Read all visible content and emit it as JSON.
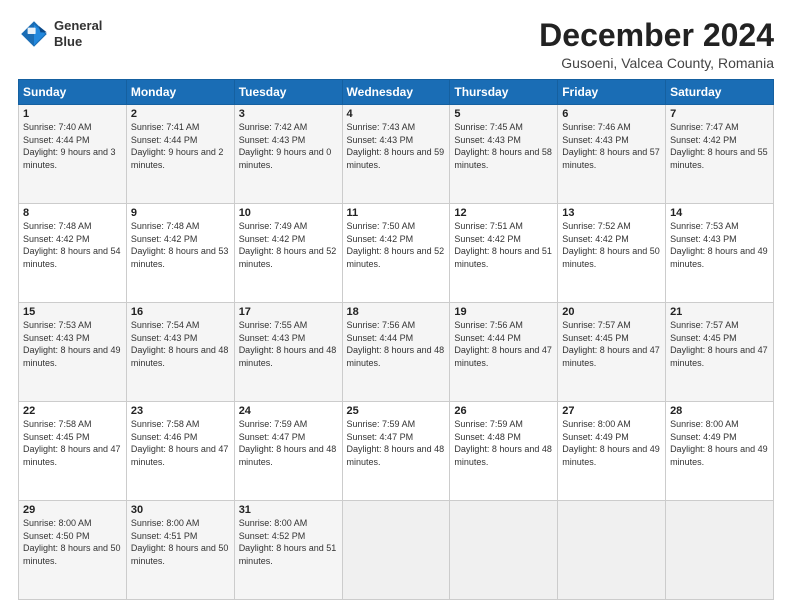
{
  "logo": {
    "line1": "General",
    "line2": "Blue"
  },
  "title": "December 2024",
  "subtitle": "Gusoeni, Valcea County, Romania",
  "days_of_week": [
    "Sunday",
    "Monday",
    "Tuesday",
    "Wednesday",
    "Thursday",
    "Friday",
    "Saturday"
  ],
  "weeks": [
    [
      {
        "day": "1",
        "sunrise": "Sunrise: 7:40 AM",
        "sunset": "Sunset: 4:44 PM",
        "daylight": "Daylight: 9 hours and 3 minutes."
      },
      {
        "day": "2",
        "sunrise": "Sunrise: 7:41 AM",
        "sunset": "Sunset: 4:44 PM",
        "daylight": "Daylight: 9 hours and 2 minutes."
      },
      {
        "day": "3",
        "sunrise": "Sunrise: 7:42 AM",
        "sunset": "Sunset: 4:43 PM",
        "daylight": "Daylight: 9 hours and 0 minutes."
      },
      {
        "day": "4",
        "sunrise": "Sunrise: 7:43 AM",
        "sunset": "Sunset: 4:43 PM",
        "daylight": "Daylight: 8 hours and 59 minutes."
      },
      {
        "day": "5",
        "sunrise": "Sunrise: 7:45 AM",
        "sunset": "Sunset: 4:43 PM",
        "daylight": "Daylight: 8 hours and 58 minutes."
      },
      {
        "day": "6",
        "sunrise": "Sunrise: 7:46 AM",
        "sunset": "Sunset: 4:43 PM",
        "daylight": "Daylight: 8 hours and 57 minutes."
      },
      {
        "day": "7",
        "sunrise": "Sunrise: 7:47 AM",
        "sunset": "Sunset: 4:42 PM",
        "daylight": "Daylight: 8 hours and 55 minutes."
      }
    ],
    [
      {
        "day": "8",
        "sunrise": "Sunrise: 7:48 AM",
        "sunset": "Sunset: 4:42 PM",
        "daylight": "Daylight: 8 hours and 54 minutes."
      },
      {
        "day": "9",
        "sunrise": "Sunrise: 7:48 AM",
        "sunset": "Sunset: 4:42 PM",
        "daylight": "Daylight: 8 hours and 53 minutes."
      },
      {
        "day": "10",
        "sunrise": "Sunrise: 7:49 AM",
        "sunset": "Sunset: 4:42 PM",
        "daylight": "Daylight: 8 hours and 52 minutes."
      },
      {
        "day": "11",
        "sunrise": "Sunrise: 7:50 AM",
        "sunset": "Sunset: 4:42 PM",
        "daylight": "Daylight: 8 hours and 52 minutes."
      },
      {
        "day": "12",
        "sunrise": "Sunrise: 7:51 AM",
        "sunset": "Sunset: 4:42 PM",
        "daylight": "Daylight: 8 hours and 51 minutes."
      },
      {
        "day": "13",
        "sunrise": "Sunrise: 7:52 AM",
        "sunset": "Sunset: 4:42 PM",
        "daylight": "Daylight: 8 hours and 50 minutes."
      },
      {
        "day": "14",
        "sunrise": "Sunrise: 7:53 AM",
        "sunset": "Sunset: 4:43 PM",
        "daylight": "Daylight: 8 hours and 49 minutes."
      }
    ],
    [
      {
        "day": "15",
        "sunrise": "Sunrise: 7:53 AM",
        "sunset": "Sunset: 4:43 PM",
        "daylight": "Daylight: 8 hours and 49 minutes."
      },
      {
        "day": "16",
        "sunrise": "Sunrise: 7:54 AM",
        "sunset": "Sunset: 4:43 PM",
        "daylight": "Daylight: 8 hours and 48 minutes."
      },
      {
        "day": "17",
        "sunrise": "Sunrise: 7:55 AM",
        "sunset": "Sunset: 4:43 PM",
        "daylight": "Daylight: 8 hours and 48 minutes."
      },
      {
        "day": "18",
        "sunrise": "Sunrise: 7:56 AM",
        "sunset": "Sunset: 4:44 PM",
        "daylight": "Daylight: 8 hours and 48 minutes."
      },
      {
        "day": "19",
        "sunrise": "Sunrise: 7:56 AM",
        "sunset": "Sunset: 4:44 PM",
        "daylight": "Daylight: 8 hours and 47 minutes."
      },
      {
        "day": "20",
        "sunrise": "Sunrise: 7:57 AM",
        "sunset": "Sunset: 4:45 PM",
        "daylight": "Daylight: 8 hours and 47 minutes."
      },
      {
        "day": "21",
        "sunrise": "Sunrise: 7:57 AM",
        "sunset": "Sunset: 4:45 PM",
        "daylight": "Daylight: 8 hours and 47 minutes."
      }
    ],
    [
      {
        "day": "22",
        "sunrise": "Sunrise: 7:58 AM",
        "sunset": "Sunset: 4:45 PM",
        "daylight": "Daylight: 8 hours and 47 minutes."
      },
      {
        "day": "23",
        "sunrise": "Sunrise: 7:58 AM",
        "sunset": "Sunset: 4:46 PM",
        "daylight": "Daylight: 8 hours and 47 minutes."
      },
      {
        "day": "24",
        "sunrise": "Sunrise: 7:59 AM",
        "sunset": "Sunset: 4:47 PM",
        "daylight": "Daylight: 8 hours and 48 minutes."
      },
      {
        "day": "25",
        "sunrise": "Sunrise: 7:59 AM",
        "sunset": "Sunset: 4:47 PM",
        "daylight": "Daylight: 8 hours and 48 minutes."
      },
      {
        "day": "26",
        "sunrise": "Sunrise: 7:59 AM",
        "sunset": "Sunset: 4:48 PM",
        "daylight": "Daylight: 8 hours and 48 minutes."
      },
      {
        "day": "27",
        "sunrise": "Sunrise: 8:00 AM",
        "sunset": "Sunset: 4:49 PM",
        "daylight": "Daylight: 8 hours and 49 minutes."
      },
      {
        "day": "28",
        "sunrise": "Sunrise: 8:00 AM",
        "sunset": "Sunset: 4:49 PM",
        "daylight": "Daylight: 8 hours and 49 minutes."
      }
    ],
    [
      {
        "day": "29",
        "sunrise": "Sunrise: 8:00 AM",
        "sunset": "Sunset: 4:50 PM",
        "daylight": "Daylight: 8 hours and 50 minutes."
      },
      {
        "day": "30",
        "sunrise": "Sunrise: 8:00 AM",
        "sunset": "Sunset: 4:51 PM",
        "daylight": "Daylight: 8 hours and 50 minutes."
      },
      {
        "day": "31",
        "sunrise": "Sunrise: 8:00 AM",
        "sunset": "Sunset: 4:52 PM",
        "daylight": "Daylight: 8 hours and 51 minutes."
      },
      null,
      null,
      null,
      null
    ]
  ]
}
